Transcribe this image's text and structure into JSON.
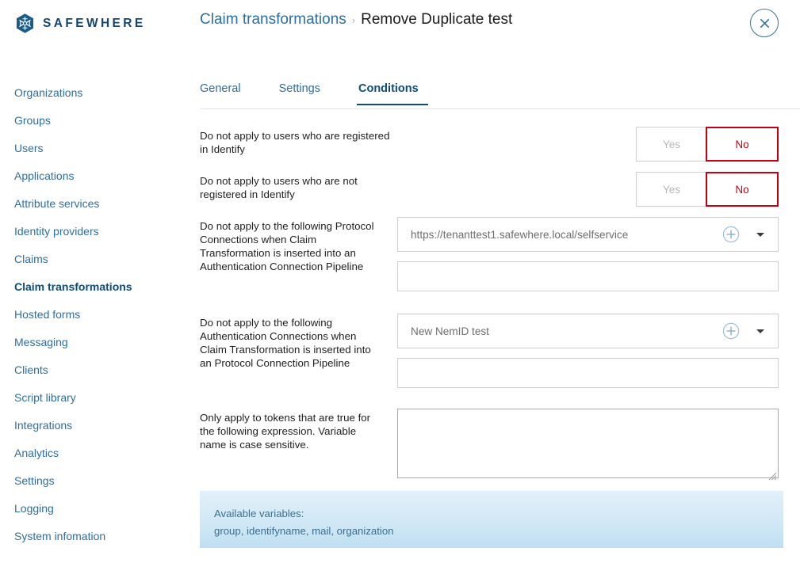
{
  "header": {
    "brand_name": "SAFEWHERE",
    "logo_icon": "snowflake-hex-logo",
    "breadcrumb_parent": "Claim transformations",
    "breadcrumb_separator": "›",
    "breadcrumb_current": "Remove Duplicate test",
    "close_icon": "close-x-icon"
  },
  "sidebar": {
    "items": [
      {
        "label": "Organizations",
        "active": false
      },
      {
        "label": "Groups",
        "active": false
      },
      {
        "label": "Users",
        "active": false
      },
      {
        "label": "Applications",
        "active": false
      },
      {
        "label": "Attribute services",
        "active": false
      },
      {
        "label": "Identity providers",
        "active": false
      },
      {
        "label": "Claims",
        "active": false
      },
      {
        "label": "Claim transformations",
        "active": true
      },
      {
        "label": "Hosted forms",
        "active": false
      },
      {
        "label": "Messaging",
        "active": false
      },
      {
        "label": "Clients",
        "active": false
      },
      {
        "label": "Script library",
        "active": false
      },
      {
        "label": "Integrations",
        "active": false
      },
      {
        "label": "Analytics",
        "active": false
      },
      {
        "label": "Settings",
        "active": false
      },
      {
        "label": "Logging",
        "active": false
      },
      {
        "label": "System infomation",
        "active": false
      }
    ]
  },
  "tabs": [
    {
      "label": "General",
      "active": false
    },
    {
      "label": "Settings",
      "active": false
    },
    {
      "label": "Conditions",
      "active": true
    }
  ],
  "form": {
    "toggle_rows": [
      {
        "label": "Do not apply to users who are registered in Identify",
        "yes_label": "Yes",
        "no_label": "No",
        "selected": "No"
      },
      {
        "label": "Do not apply to users who are not registered in Identify",
        "yes_label": "Yes",
        "no_label": "No",
        "selected": "No"
      }
    ],
    "select_rows": [
      {
        "label": "Do not apply to the following Protocol Connections when Claim Transformation is inserted into an Authentication Connection Pipeline",
        "value": "https://tenanttest1.safewhere.local/selfservice",
        "add_icon": "plus-circle-icon",
        "caret_icon": "chevron-down-icon",
        "tags_value": ""
      },
      {
        "label": "Do not apply to the following Authentication Connections when Claim Transformation is inserted into an Protocol Connection Pipeline",
        "value": "New NemID test",
        "add_icon": "plus-circle-icon",
        "caret_icon": "chevron-down-icon",
        "tags_value": ""
      }
    ],
    "expression_row": {
      "label": "Only apply to tokens that are true for the following expression. Variable name is case sensitive.",
      "value": "",
      "placeholder": "",
      "resize_icon": "resize-grip-icon"
    }
  },
  "info_box": {
    "title": "Available variables:",
    "variables": "group, identifyname, mail, organization"
  },
  "colors": {
    "brand_blue": "#13466e",
    "link_blue": "#2e6ea0",
    "active_blue": "#0f4c7a",
    "danger_red": "#c20016",
    "muted_gray": "#b7b7b7",
    "border_gray": "#cfcfcf",
    "info_blue": "#cfe7f5"
  }
}
